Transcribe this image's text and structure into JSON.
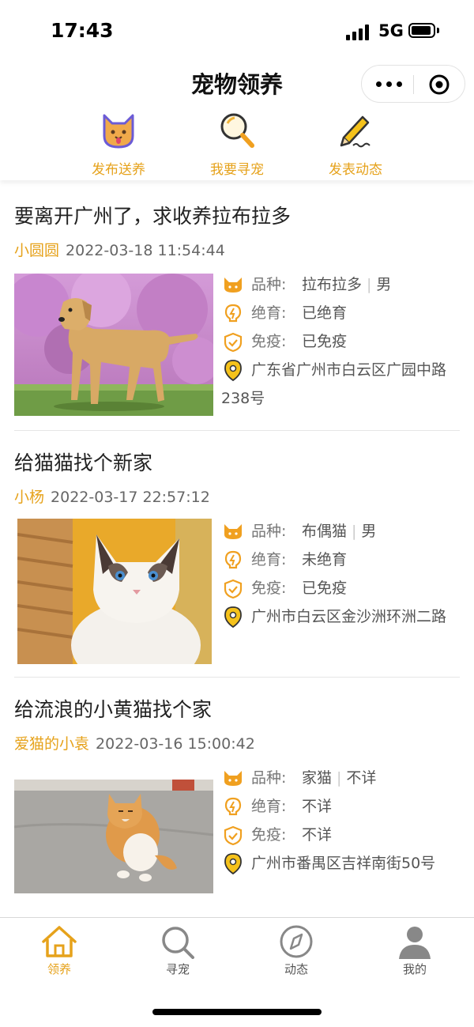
{
  "status_bar": {
    "time": "17:43",
    "network": "5G"
  },
  "nav": {
    "title": "宠物领养"
  },
  "quick_actions": [
    {
      "label": "发布送养",
      "icon": "cat-face-icon"
    },
    {
      "label": "我要寻宠",
      "icon": "magnifier-icon"
    },
    {
      "label": "发表动态",
      "icon": "pencil-icon"
    }
  ],
  "info_labels": {
    "breed": "品种:",
    "neuter": "绝育:",
    "vaccine": "免疫:"
  },
  "posts": [
    {
      "title": "要离开广州了，求收养拉布拉多",
      "author": "小圆圆",
      "time": "2022-03-18 11:54:44",
      "breed": "拉布拉多",
      "sex": "男",
      "neuter": "已绝育",
      "vaccine": "已免疫",
      "address": "广东省广州市白云区广园中路238号"
    },
    {
      "title": "给猫猫找个新家",
      "author": "小杨",
      "time": "2022-03-17 22:57:12",
      "breed": "布偶猫",
      "sex": "男",
      "neuter": "未绝育",
      "vaccine": "已免疫",
      "address": "广州市白云区金沙洲环洲二路"
    },
    {
      "title": "给流浪的小黄猫找个家",
      "author": "爱猫的小袁",
      "time": "2022-03-16 15:00:42",
      "breed": "家猫",
      "sex": "不详",
      "neuter": "不详",
      "vaccine": "不详",
      "address": "广州市番禺区吉祥南街50号"
    }
  ],
  "tab_bar": [
    {
      "label": "领养",
      "icon": "home-icon",
      "active": true
    },
    {
      "label": "寻宠",
      "icon": "search-icon",
      "active": false
    },
    {
      "label": "动态",
      "icon": "compass-icon",
      "active": false
    },
    {
      "label": "我的",
      "icon": "user-icon",
      "active": false
    }
  ],
  "colors": {
    "accent": "#e6a21b",
    "text": "#333333",
    "divider": "#e6e6e6"
  }
}
